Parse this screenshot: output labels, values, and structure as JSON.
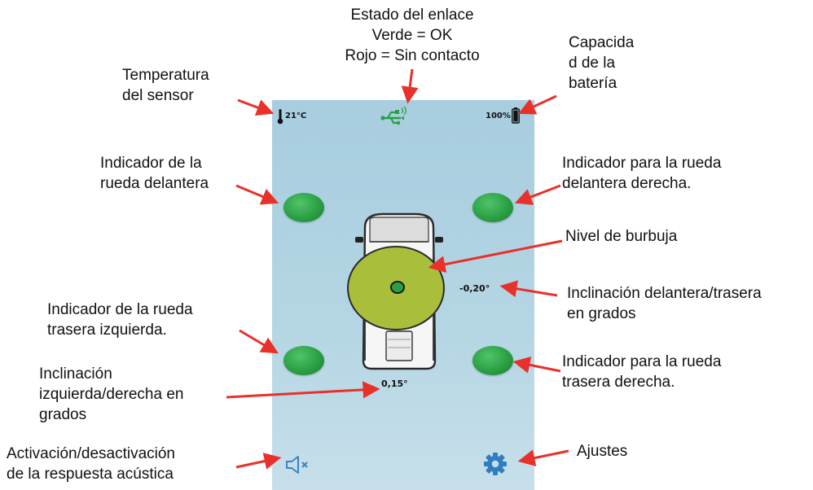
{
  "labels": {
    "link_status_line1": "Estado del enlace",
    "link_status_line2": "Verde = OK",
    "link_status_line3": "Rojo = Sin contacto",
    "sensor_temp_line1": "Temperatura",
    "sensor_temp_line2": "del sensor",
    "battery_line1": "Capacida",
    "battery_line2": "d de la",
    "battery_line3": "batería",
    "front_left_line1": "Indicador de la",
    "front_left_line2": "rueda delantera",
    "front_right_line1": "Indicador para la rueda",
    "front_right_line2": "delantera derecha.",
    "bubble_level": "Nivel de burbuja",
    "front_rear_tilt_line1": "Inclinación delantera/trasera",
    "front_rear_tilt_line2": "en grados",
    "rear_left_line1": "Indicador de la rueda",
    "rear_left_line2": "trasera izquierda.",
    "rear_right_line1": "Indicador para la rueda",
    "rear_right_line2": "trasera derecha.",
    "left_right_tilt_line1": "Inclinación",
    "left_right_tilt_line2": "izquierda/derecha en",
    "left_right_tilt_line3": "grados",
    "sound_toggle_line1": "Activación/desactivación",
    "sound_toggle_line2": "de la respuesta acústica",
    "settings": "Ajustes"
  },
  "app": {
    "temperature": "21°C",
    "battery": "100%",
    "front_rear_tilt": "-0,20°",
    "left_right_tilt": "0,15°"
  },
  "colors": {
    "screen_bg": "#b0d3e2",
    "wheel_green": "#2aa043",
    "bubble_level": "#a9bf3c",
    "link_icon": "#2aa043",
    "arrow": "#e8312a",
    "settings_icon": "#2f7fc0"
  },
  "icons": {
    "temperature": "thermometer-icon",
    "link": "usb-link-icon",
    "battery": "battery-icon",
    "sound": "speaker-muted-icon",
    "settings": "gear-icon"
  }
}
